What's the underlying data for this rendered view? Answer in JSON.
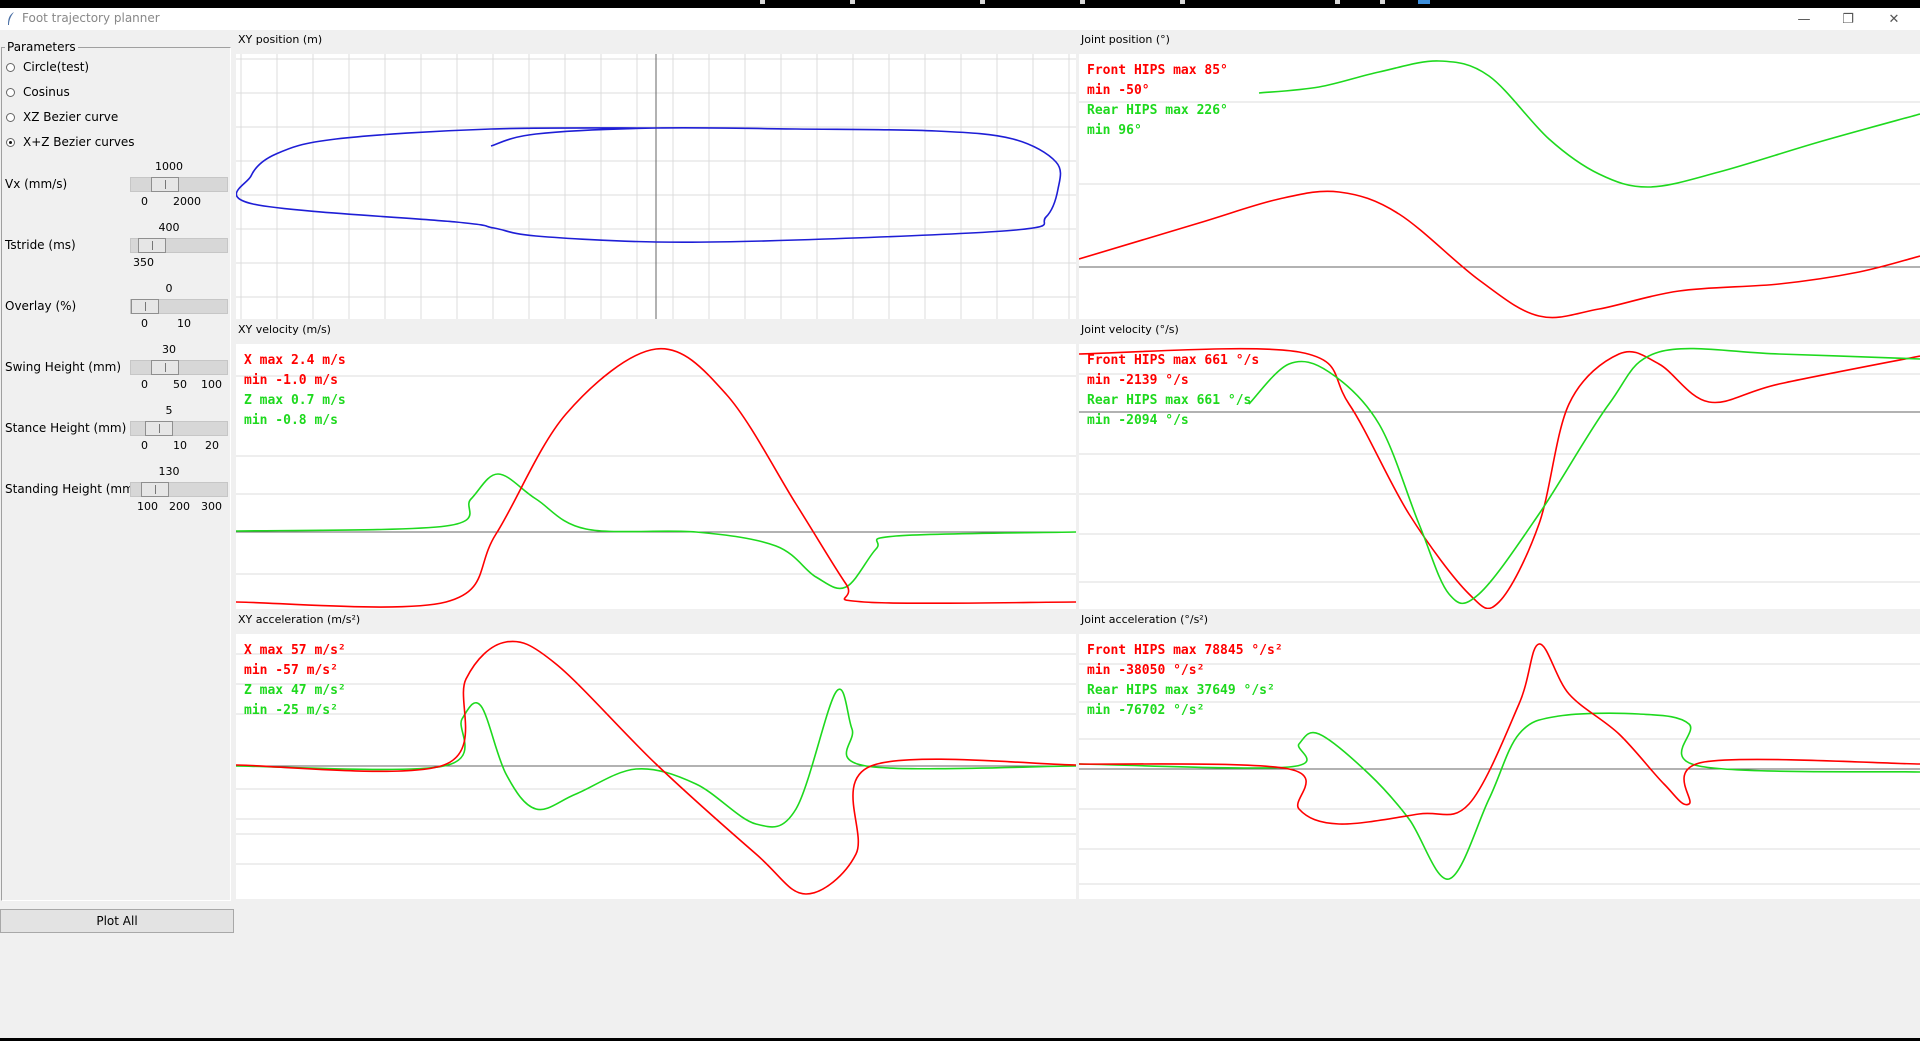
{
  "window": {
    "title": "Foot trajectory planner",
    "min_glyph": "—",
    "max_glyph": "❐",
    "close_glyph": "✕"
  },
  "parameters": {
    "title": "Parameters",
    "modes": [
      {
        "label": "Circle(test)",
        "selected": false
      },
      {
        "label": "Cosinus",
        "selected": false
      },
      {
        "label": "XZ Bezier curve",
        "selected": false
      },
      {
        "label": "X+Z Bezier curves",
        "selected": true
      }
    ],
    "sliders": [
      {
        "label": "Vx (mm/s)",
        "value": "1000",
        "ticks": [
          "0",
          "2000"
        ],
        "level": 0.3
      },
      {
        "label": "Tstride (ms)",
        "value": "400",
        "ticks": [
          "350"
        ],
        "level": 0.1
      },
      {
        "label": "Overlay (%)",
        "value": "0",
        "ticks": [
          "0",
          "10"
        ],
        "level": 0.0
      },
      {
        "label": "Swing Height (mm)",
        "value": "30",
        "ticks": [
          "0",
          "50",
          "100"
        ],
        "level": 0.3
      },
      {
        "label": "Stance Height (mm)",
        "value": "5",
        "ticks": [
          "0",
          "10",
          "20"
        ],
        "level": 0.2
      },
      {
        "label": "Standing Height (mm)",
        "value": "130",
        "ticks": [
          "100",
          "200",
          "300"
        ],
        "level": 0.15
      }
    ],
    "plot_button": "Plot All"
  },
  "colors": {
    "red": "#ff0000",
    "green": "#1ed91e",
    "blue": "#1e1ed6",
    "axis": "#666666",
    "grid": "#dcdcdc",
    "plot_bg": "#ffffff"
  },
  "panels": {
    "xy_position": {
      "title": "XY position (m)"
    },
    "joint_position": {
      "title": "Joint position (°)",
      "stats": [
        "Front HIPS max 85°",
        "         min -50°",
        "Rear HIPS  max 226°",
        "           min 96°"
      ]
    },
    "xy_velocity": {
      "title": "XY velocity (m/s)",
      "stats": [
        "X max 2.4 m/s",
        "  min -1.0 m/s",
        "Z max 0.7 m/s",
        "  min -0.8 m/s"
      ]
    },
    "joint_velocity": {
      "title": "Joint velocity (°/s)",
      "stats": [
        "Front HIPS max 661 °/s",
        "           min -2139 °/s",
        "Rear HIPS  max 661 °/s",
        "           min -2094 °/s"
      ]
    },
    "xy_acceleration": {
      "title": "XY acceleration (m/s²)",
      "stats": [
        "X max 57 m/s²",
        "  min -57 m/s²",
        "Z max 47 m/s²",
        "  min -25 m/s²"
      ]
    },
    "joint_acceleration": {
      "title": "Joint acceleration (°/s²)",
      "stats": [
        "Front HIPS max 78845 °/s²",
        "           min -38050 °/s²",
        "Rear HIPS  max 37649 °/s²",
        "           min -76702 °/s²"
      ]
    }
  }
}
